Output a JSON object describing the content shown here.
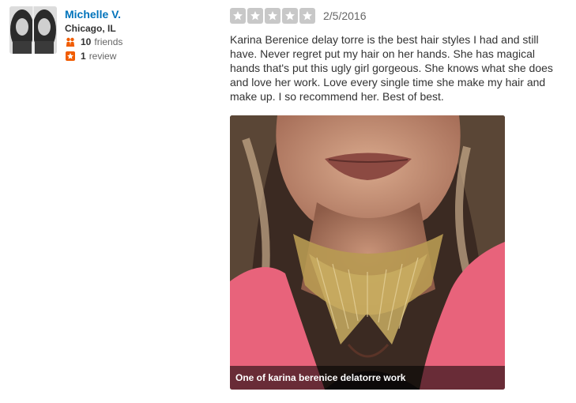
{
  "user": {
    "name": "Michelle V.",
    "location": "Chicago, IL",
    "friends_count": "10",
    "friends_label": "friends",
    "reviews_count": "1",
    "reviews_label": "review",
    "avatar_icon": "user-avatar-photo",
    "friends_icon": "friends-icon",
    "review_icon": "review-star-icon"
  },
  "review": {
    "rating": 5,
    "rating_max": 5,
    "date": "2/5/2016",
    "text": "Karina Berenice delay torre is the best hair styles I had and still have. Never regret put my hair on her hands. She has magical hands that's put this ugly girl gorgeous. She knows what she does and love her work. Love every single time she make my hair and make up. I so recommend her. Best of best.",
    "star_color": "#c8c8c8"
  },
  "photo": {
    "caption": "One of karina berenice delatorre work"
  },
  "colors": {
    "link": "#0073bb",
    "accent_orange": "#f15c00"
  }
}
